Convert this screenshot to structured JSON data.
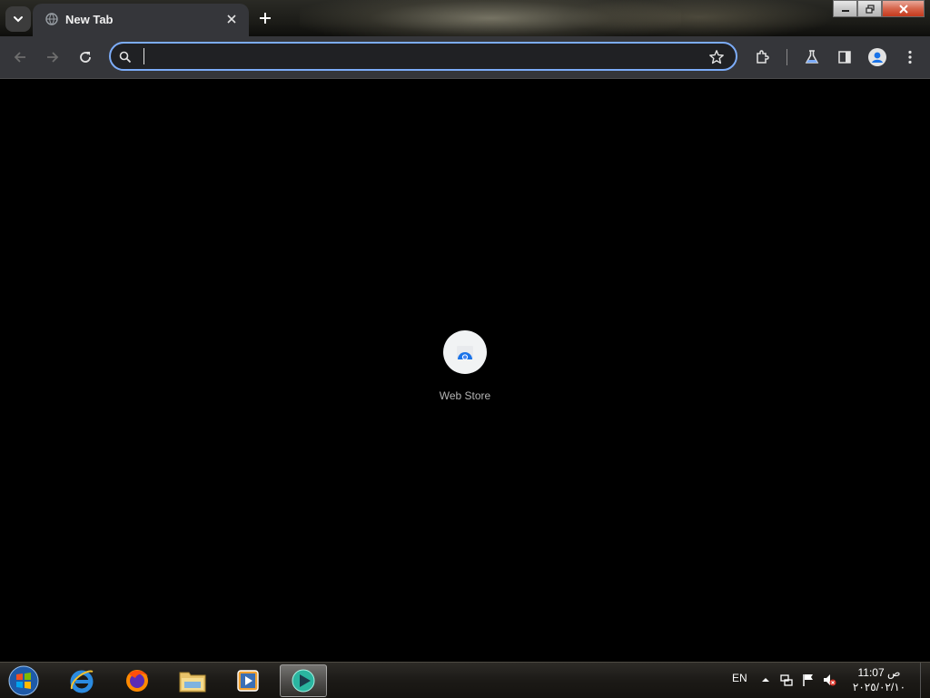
{
  "browser": {
    "tab": {
      "title": "New Tab",
      "favicon": "globe-icon"
    },
    "omnibox": {
      "value": "",
      "placeholder": ""
    }
  },
  "shortcuts": [
    {
      "label": "Web Store",
      "icon": "chrome-web-store-icon"
    }
  ],
  "taskbar": {
    "apps": [
      "internet-explorer-icon",
      "firefox-icon",
      "file-explorer-icon",
      "media-player-icon",
      "chrome-app-icon"
    ],
    "language": "EN",
    "time": "11:07 ص",
    "date": "٢٠٢٥/٠٢/١٠"
  },
  "colors": {
    "accent": "#7cacf8",
    "toolbar": "#35363a",
    "content_bg": "#000000"
  }
}
